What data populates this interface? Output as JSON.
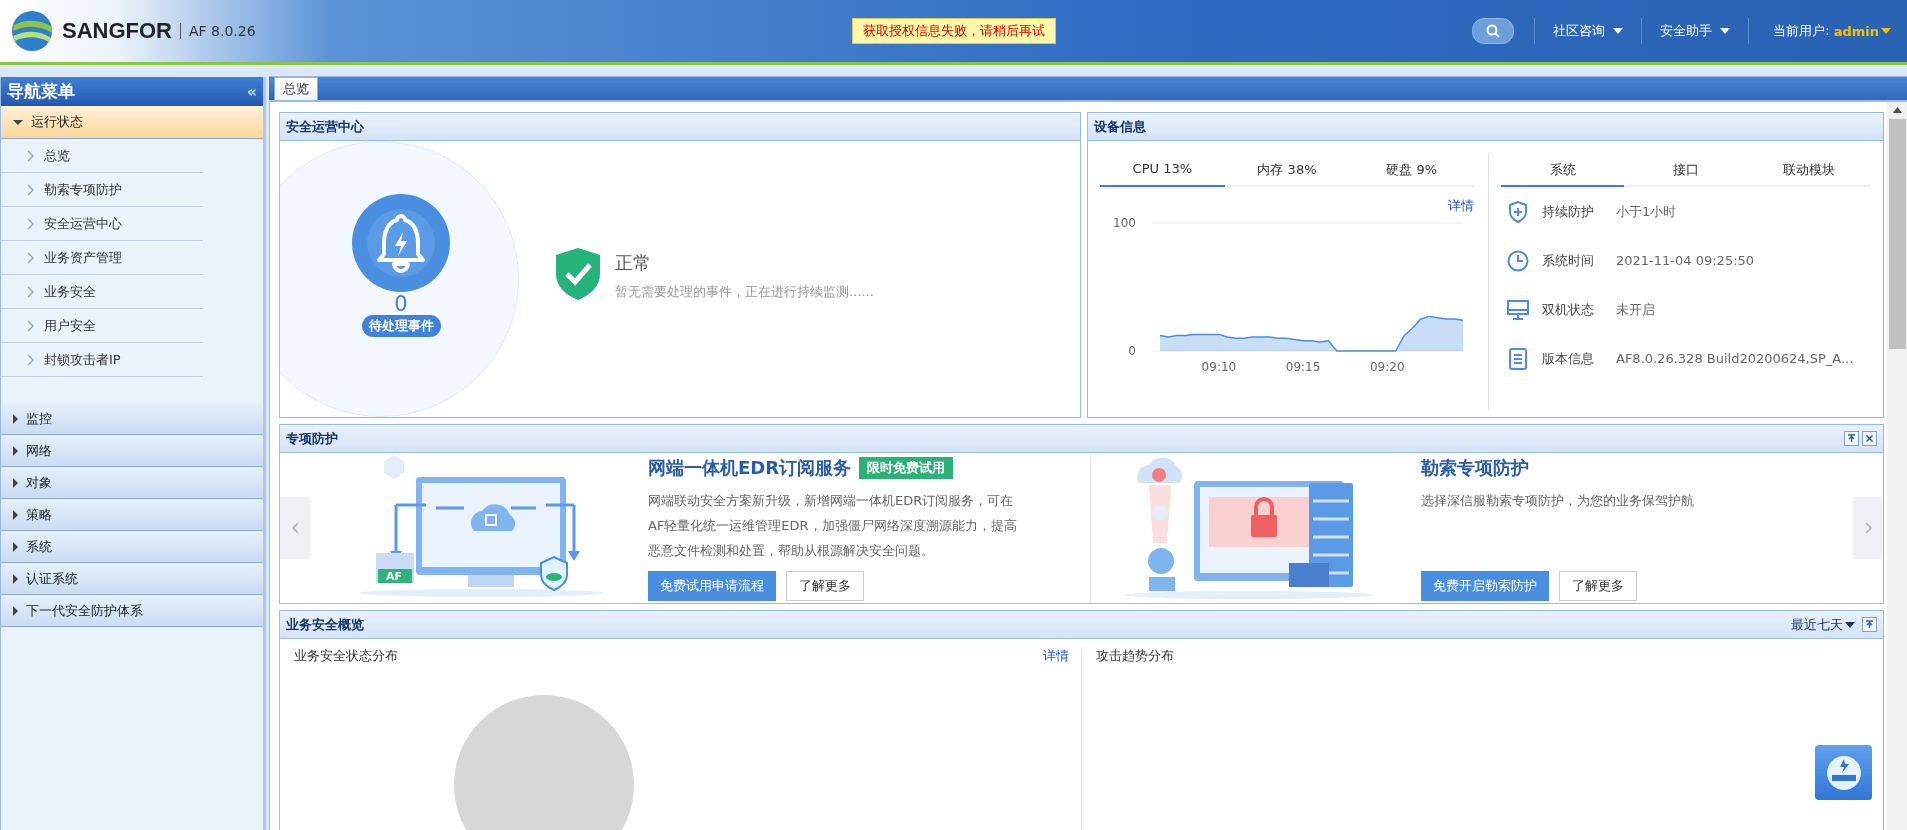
{
  "header": {
    "brand": "SANGFOR",
    "version": "AF 8.0.26",
    "alert": "获取授权信息失败，请稍后再试",
    "menus": [
      {
        "label": "社区咨询"
      },
      {
        "label": "安全助手"
      }
    ],
    "user_label": "当前用户:",
    "user": "admin"
  },
  "sidebar": {
    "title": "导航菜单",
    "collapse_glyph": "«",
    "groups": [
      {
        "label": "运行状态",
        "expanded": true,
        "children": [
          {
            "label": "总览"
          },
          {
            "label": "勒索专项防护"
          },
          {
            "label": "安全运营中心"
          },
          {
            "label": "业务资产管理"
          },
          {
            "label": "业务安全"
          },
          {
            "label": "用户安全"
          },
          {
            "label": "封锁攻击者IP"
          }
        ]
      },
      {
        "label": "监控",
        "expanded": false
      },
      {
        "label": "网络",
        "expanded": false
      },
      {
        "label": "对象",
        "expanded": false
      },
      {
        "label": "策略",
        "expanded": false
      },
      {
        "label": "系统",
        "expanded": false
      },
      {
        "label": "认证系统",
        "expanded": false
      },
      {
        "label": "下一代安全防护体系",
        "expanded": false
      }
    ]
  },
  "tabs": [
    {
      "label": "总览",
      "selected": true
    }
  ],
  "security_center": {
    "title": "安全运营中心",
    "pending_count": "0",
    "pending_label": "待处理事件",
    "status": "正常",
    "status_text": "暂无需要处理的事件，正在进行持续监测......"
  },
  "device_info": {
    "title": "设备信息",
    "resource_tabs": [
      {
        "label": "CPU 13%",
        "selected": true
      },
      {
        "label": "内存 38%",
        "selected": false
      },
      {
        "label": "硬盘 9%",
        "selected": false
      }
    ],
    "detail_link": "详情",
    "chart_data": {
      "type": "area",
      "categories": [
        null,
        null,
        null,
        null,
        null,
        null,
        null,
        "09:10",
        null,
        null,
        null,
        null,
        null,
        null,
        null,
        null,
        null,
        "09:15",
        null,
        null,
        null,
        null,
        null,
        null,
        null,
        null,
        null,
        "09:20",
        null,
        null,
        null,
        null,
        null,
        null,
        null,
        null,
        null
      ],
      "series": [
        {
          "color": "#4a8ee0",
          "values": [
            12,
            11,
            12,
            12,
            13,
            13,
            13,
            13,
            11,
            10,
            10,
            11,
            11,
            11,
            10,
            10,
            9,
            8,
            8,
            7,
            8,
            0,
            0,
            0,
            0,
            0,
            0,
            0,
            0,
            12,
            18,
            25,
            27,
            26,
            25,
            25,
            24
          ]
        }
      ],
      "ylim": [
        0,
        100
      ],
      "yticks": [
        0,
        100
      ]
    },
    "info_tabs": [
      {
        "label": "系统",
        "selected": true
      },
      {
        "label": "接口",
        "selected": false
      },
      {
        "label": "联动模块",
        "selected": false
      }
    ],
    "rows": [
      {
        "kind": "shield",
        "label": "持续防护",
        "value": "小于1小时"
      },
      {
        "kind": "clock",
        "label": "系统时间",
        "value": "2021-11-04 09:25:50"
      },
      {
        "kind": "monitor",
        "label": "双机状态",
        "value": "未开启"
      },
      {
        "kind": "document",
        "label": "版本信息",
        "value": "AF8.0.26.328 Build20200624,SP_A..."
      }
    ]
  },
  "special_protection": {
    "title": "专项防护",
    "cards": [
      {
        "kind": "edr",
        "illustration_label": "AF",
        "title": "网端一体机EDR订阅服务",
        "badge": "限时免费试用",
        "text": "网端联动安全方案新升级，新增网端一体机EDR订阅服务，可在AF轻量化统一运维管理EDR，加强僵尸网络深度溯源能力，提高恶意文件检测和处置，帮助从根源解决安全问题。",
        "primary_button": "免费试用申请流程",
        "secondary_button": "了解更多"
      },
      {
        "kind": "ransom",
        "title": "勒索专项防护",
        "text": "选择深信服勒索专项防护，为您的业务保驾护航",
        "primary_button": "免费开启勒索防护",
        "secondary_button": "了解更多"
      }
    ]
  },
  "business_overview": {
    "title": "业务安全概览",
    "range": "最近七天",
    "sections": [
      {
        "title": "业务安全状态分布",
        "link": "详情"
      },
      {
        "title": "攻击趋势分布"
      }
    ]
  }
}
